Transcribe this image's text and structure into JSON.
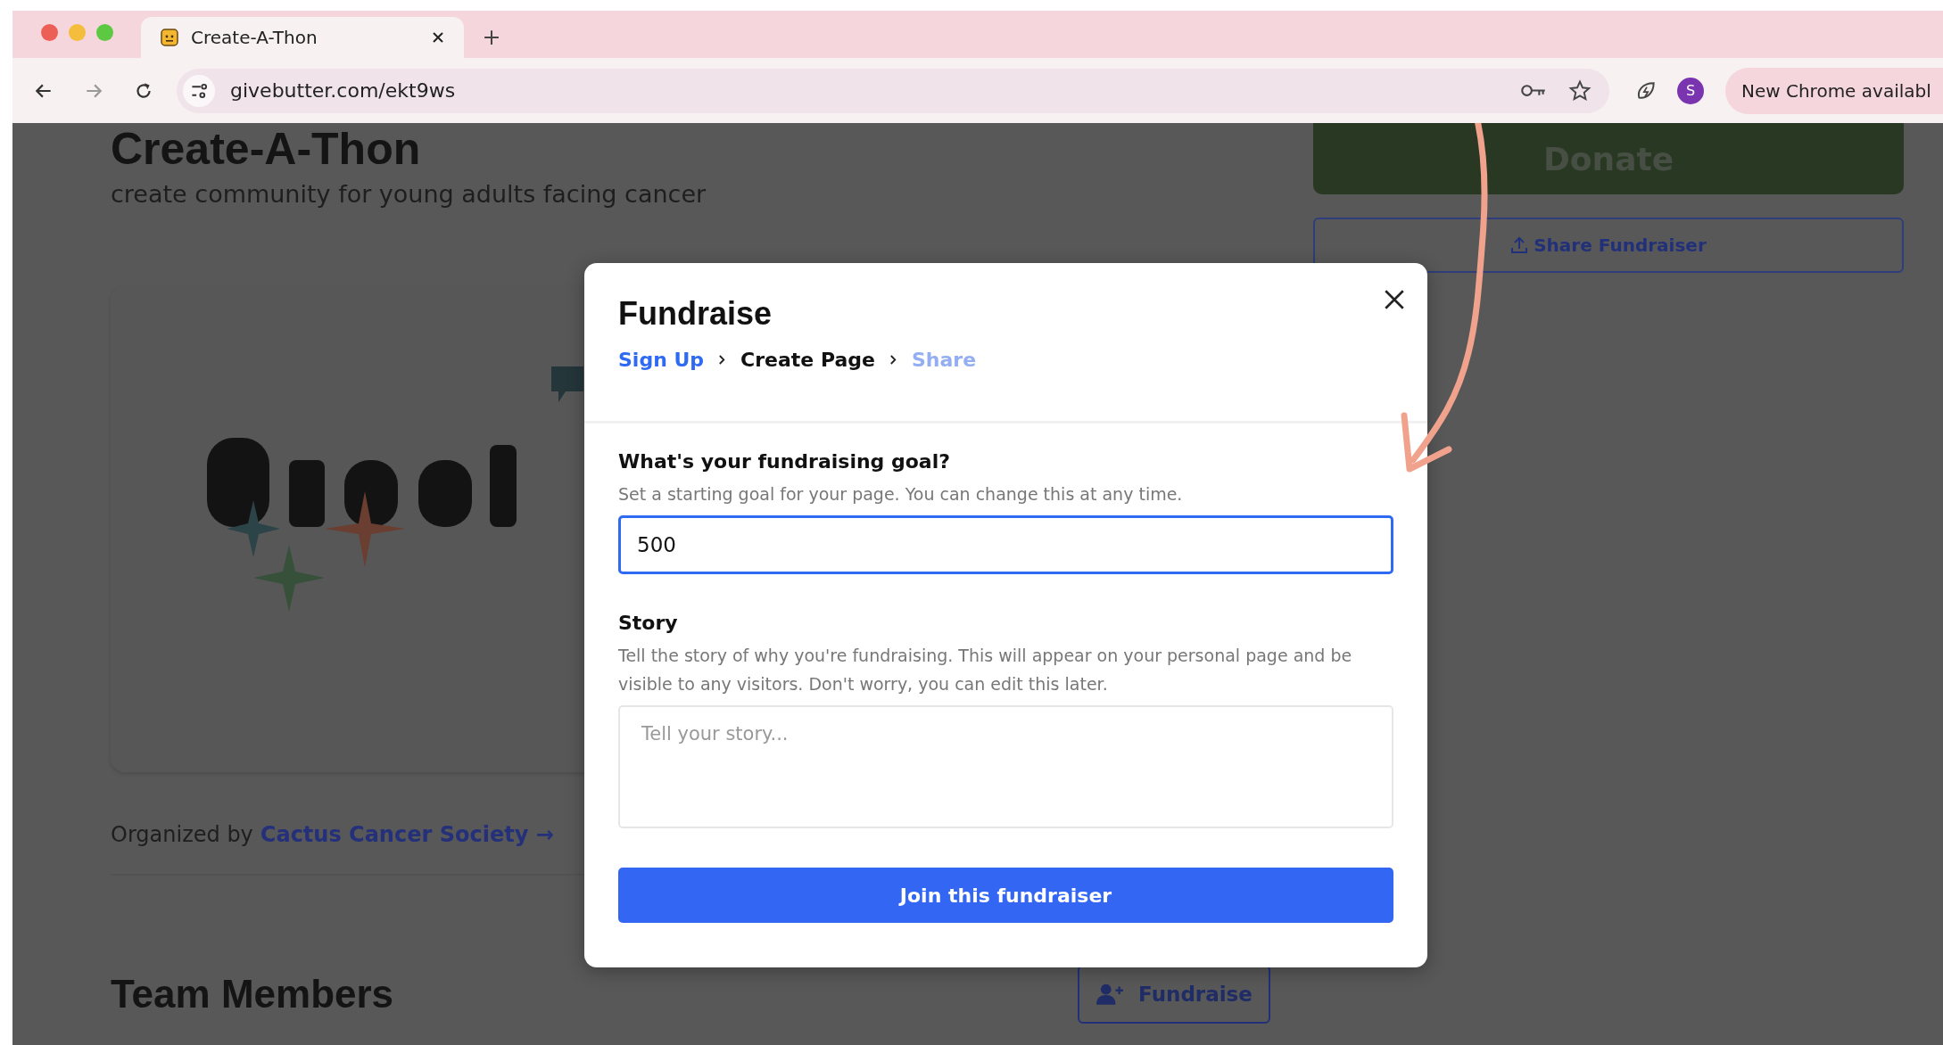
{
  "browser": {
    "tab_title": "Create-A-Thon",
    "url": "givebutter.com/ekt9ws",
    "profile_initial": "S",
    "update_pill": "New Chrome availabl"
  },
  "page": {
    "title": "Create-A-Thon",
    "tagline": "create community for young adults facing cancer",
    "organizer_prefix": "Organized by",
    "organizer_link": "Cactus Cancer Society →",
    "team_heading": "Team Members",
    "fundraise_button": "Fundraise",
    "donate_button": "Donate",
    "share_button": "Share Fundraiser"
  },
  "modal": {
    "title": "Fundraise",
    "steps": [
      {
        "label": "Sign Up",
        "completed": true,
        "selected": false
      },
      {
        "label": "Create Page",
        "completed": false,
        "selected": true
      },
      {
        "label": "Share",
        "completed": false,
        "selected": false
      }
    ],
    "goal_label": "What's your fundraising goal?",
    "goal_hint": "Set a starting goal for your page. You can change this at any time.",
    "goal_value": "500",
    "story_label": "Story",
    "story_hint": "Tell the story of why you're fundraising. This will appear on your personal page and be visible to any visitors. Don't worry, you can edit this later.",
    "story_placeholder": "Tell your story...",
    "submit_button": "Join this fundraiser"
  }
}
